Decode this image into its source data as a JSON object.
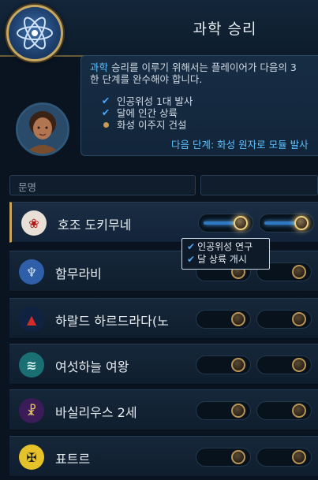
{
  "header": {
    "title": "과학 승리",
    "emblem_icon": "atom-icon"
  },
  "info": {
    "desc_highlight": "과학",
    "desc_line1_rest": " 승리를 이루기 위해서는 플레이어가 다음의 3",
    "desc_line2": "한 단계를 완수해야 합니다.",
    "requirements": [
      {
        "label": "인공위성 1대 발사",
        "status": "done"
      },
      {
        "label": "달에 인간 상륙",
        "status": "done"
      },
      {
        "label": "화성 이주지 건설",
        "status": "pending"
      }
    ],
    "next_step": "다음 단계: 화성 원자로 모듈 발사"
  },
  "columns": {
    "name_header": "문명"
  },
  "rows": [
    {
      "name": "호조 도키무네",
      "icon": "hojo-clan-icon",
      "icon_bg": "#e8e0d6",
      "icon_fg": "#b01515",
      "progress": [
        1,
        1
      ]
    },
    {
      "name": "함무라비",
      "icon": "babylon-icon",
      "icon_bg": "#2f5fa8",
      "icon_fg": "#cfe0f5",
      "progress": [
        0,
        0
      ]
    },
    {
      "name": "하랄드 하르드라다(노",
      "icon": "norway-icon",
      "icon_bg": "#0f2240",
      "icon_fg": "#d42a2a",
      "progress": [
        0,
        0
      ]
    },
    {
      "name": "여섯하늘 여왕",
      "icon": "maya-icon",
      "icon_bg": "#1a6f73",
      "icon_fg": "#d9f1ee",
      "progress": [
        0,
        0
      ]
    },
    {
      "name": "바실리우스 2세",
      "icon": "byzantium-icon",
      "icon_bg": "#3b1c58",
      "icon_fg": "#e9c65b",
      "progress": [
        0,
        0
      ]
    },
    {
      "name": "표트르",
      "icon": "russia-icon",
      "icon_bg": "#e5c22a",
      "icon_fg": "#1a1a1a",
      "progress": [
        0,
        0
      ]
    }
  ],
  "tooltip": {
    "items": [
      "인공위성 연구",
      "달 상륙 개시"
    ]
  },
  "colors": {
    "accent_blue": "#5cc0ff",
    "gold": "#c9a45c"
  }
}
